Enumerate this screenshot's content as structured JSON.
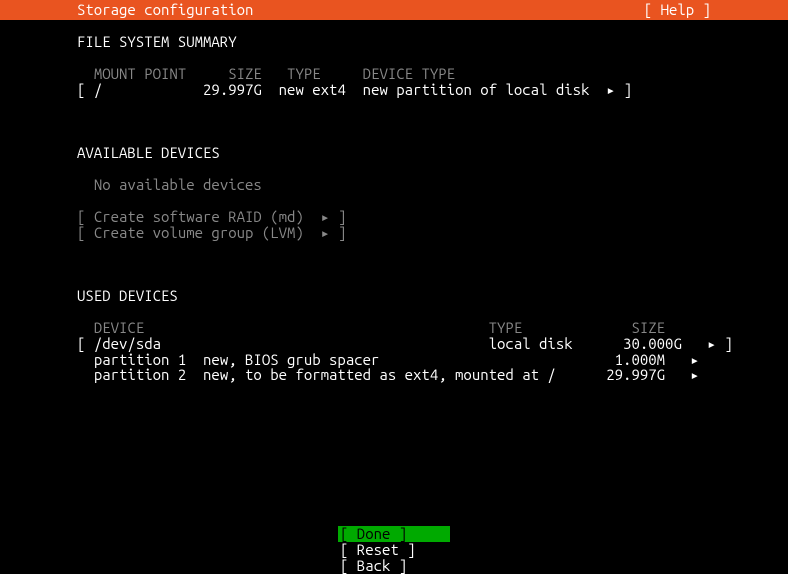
{
  "header": {
    "title": "Storage configuration",
    "help": "[ Help ]"
  },
  "filesystem": {
    "title": "FILE SYSTEM SUMMARY",
    "headers": {
      "mount": "MOUNT POINT",
      "size": "SIZE",
      "type": "TYPE",
      "device": "DEVICE TYPE"
    },
    "row": {
      "lbracket": "[",
      "mount": "/",
      "size": "29.997G",
      "type": "new ext4",
      "device": "new partition of local disk",
      "arrow": "▸",
      "rbracket": "]"
    }
  },
  "available": {
    "title": "AVAILABLE DEVICES",
    "none": "No available devices",
    "raid": {
      "lbracket": "[",
      "label": "Create software RAID (md)",
      "arrow": "▸",
      "rbracket": "]"
    },
    "lvm": {
      "lbracket": "[",
      "label": "Create volume group (LVM)",
      "arrow": "▸",
      "rbracket": "]"
    }
  },
  "used": {
    "title": "USED DEVICES",
    "headers": {
      "device": "DEVICE",
      "type": "TYPE",
      "size": "SIZE"
    },
    "disk": {
      "lbracket": "[",
      "name": "/dev/sda",
      "type": "local disk",
      "size": "30.000G",
      "arrow": "▸",
      "rbracket": "]"
    },
    "part1": {
      "name": "partition 1",
      "desc": "new, BIOS grub spacer",
      "size": "1.000M",
      "arrow": "▸"
    },
    "part2": {
      "name": "partition 2",
      "desc": "new, to be formatted as ext4, mounted at /",
      "size": "29.997G",
      "arrow": "▸"
    }
  },
  "buttons": {
    "done": {
      "lbracket": "[",
      "label": " Done       ",
      "rbracket": "]"
    },
    "reset": {
      "lbracket": "[",
      "label": " Reset      ",
      "rbracket": "]"
    },
    "back": {
      "lbracket": "[",
      "label": " Back       ",
      "rbracket": "]"
    }
  }
}
